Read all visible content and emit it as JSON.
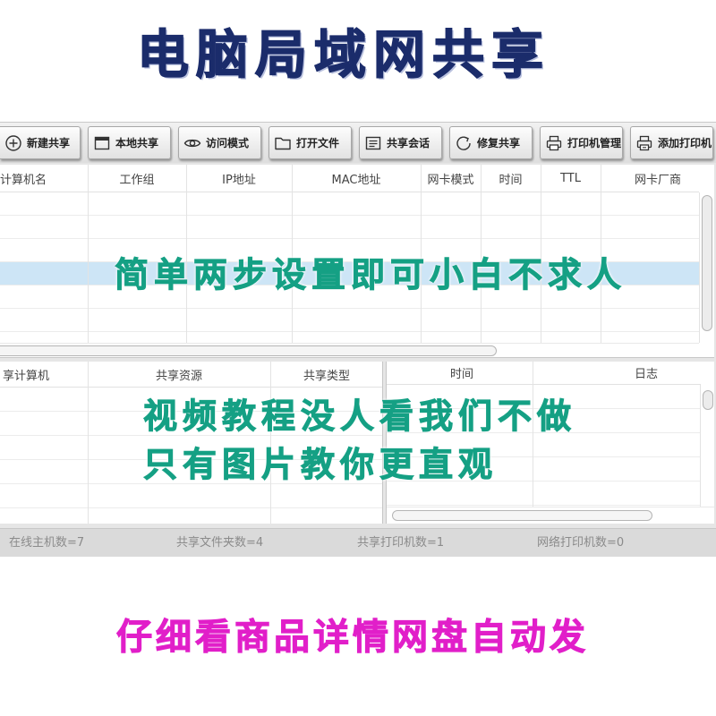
{
  "header": {
    "title": "电脑局域网共享"
  },
  "toolbar": {
    "buttons": [
      {
        "label": "新建共享",
        "icon": "plus-circle-icon"
      },
      {
        "label": "本地共享",
        "icon": "window-icon"
      },
      {
        "label": "访问模式",
        "icon": "eye-icon"
      },
      {
        "label": "打开文件",
        "icon": "folder-icon"
      },
      {
        "label": "共享会话",
        "icon": "document-icon"
      },
      {
        "label": "修复共享",
        "icon": "refresh-icon"
      },
      {
        "label": "打印机管理",
        "icon": "printer-icon"
      },
      {
        "label": "添加打印机",
        "icon": "printer-add-icon"
      }
    ]
  },
  "hosts_table": {
    "columns": [
      "计算机名",
      "工作组",
      "IP地址",
      "MAC地址",
      "网卡模式",
      "时间",
      "TTL",
      "网卡厂商"
    ],
    "selected_row": 4
  },
  "shares_table": {
    "columns": [
      "享计算机",
      "共享资源",
      "共享类型"
    ]
  },
  "log_table": {
    "columns": [
      "时间",
      "日志"
    ]
  },
  "status_bar": {
    "items": [
      "在线主机数=7",
      "共享文件夹数=4",
      "共享打印机数=1",
      "网络打印机数=0"
    ]
  },
  "promo": {
    "overlay_lines": [
      "简单两步设置即可小白不求人",
      "视频教程没人看我们不做",
      "只有图片教你更直观"
    ],
    "footer": "仔细看商品详情网盘自动发"
  },
  "colors": {
    "title": "#1b2c6b",
    "overlay_text": "#15a084",
    "footer_text": "#e11fc9",
    "selected_row": "#cde5f6"
  }
}
